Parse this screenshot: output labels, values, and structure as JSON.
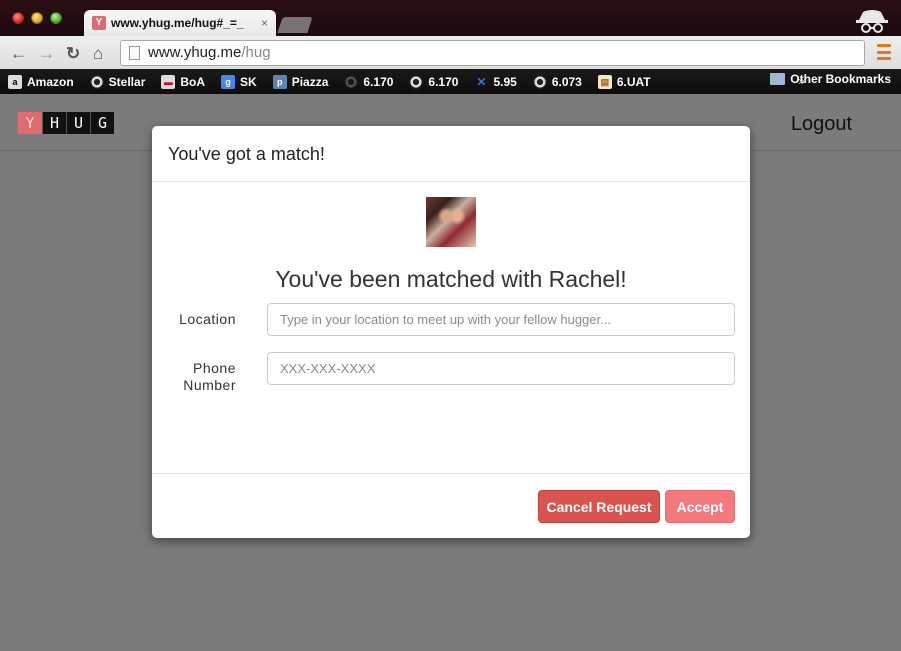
{
  "browser": {
    "tab_title": "www.yhug.me/hug#_=_",
    "tab_close": "×",
    "url_host": "www.yhug.me",
    "url_path": "/hug",
    "bookmarks": [
      {
        "label": "Amazon",
        "icon": "amazon-icon",
        "glyph": "a"
      },
      {
        "label": "Stellar",
        "icon": "stellar-icon",
        "glyph": ""
      },
      {
        "label": "BoA",
        "icon": "bank-of-america-icon",
        "glyph": "▬"
      },
      {
        "label": "SK",
        "icon": "google-icon",
        "glyph": "g"
      },
      {
        "label": "Piazza",
        "icon": "piazza-icon",
        "glyph": "p"
      },
      {
        "label": "6.170",
        "icon": "stellar-ring-icon",
        "glyph": ""
      },
      {
        "label": "6.170",
        "icon": "stellar-ring-icon",
        "glyph": ""
      },
      {
        "label": "5.95",
        "icon": "x-icon",
        "glyph": "✕"
      },
      {
        "label": "6.073",
        "icon": "stellar-ring-icon",
        "glyph": ""
      },
      {
        "label": "6.UAT",
        "icon": "document-icon",
        "glyph": "▤"
      }
    ],
    "bookmarks_more": "»",
    "other_bookmarks": "Other Bookmarks"
  },
  "header": {
    "logo_letters": [
      "Y",
      "H",
      "U",
      "G"
    ],
    "logout": "Logout"
  },
  "modal": {
    "title": "You've got a match!",
    "headline": "You've been matched with Rachel!",
    "location_label": "Location",
    "location_placeholder": "Type in your location to meet up with your fellow hugger...",
    "phone_label_line1": "Phone",
    "phone_label_line2": "Number",
    "phone_placeholder": "XXX-XXX-XXXX",
    "cancel_button": "Cancel Request",
    "accept_button": "Accept"
  },
  "colors": {
    "brand": "#e06a6e",
    "cancel": "#d9534f",
    "accept": "#f27a7e",
    "overlay": "#7a7a7a"
  }
}
